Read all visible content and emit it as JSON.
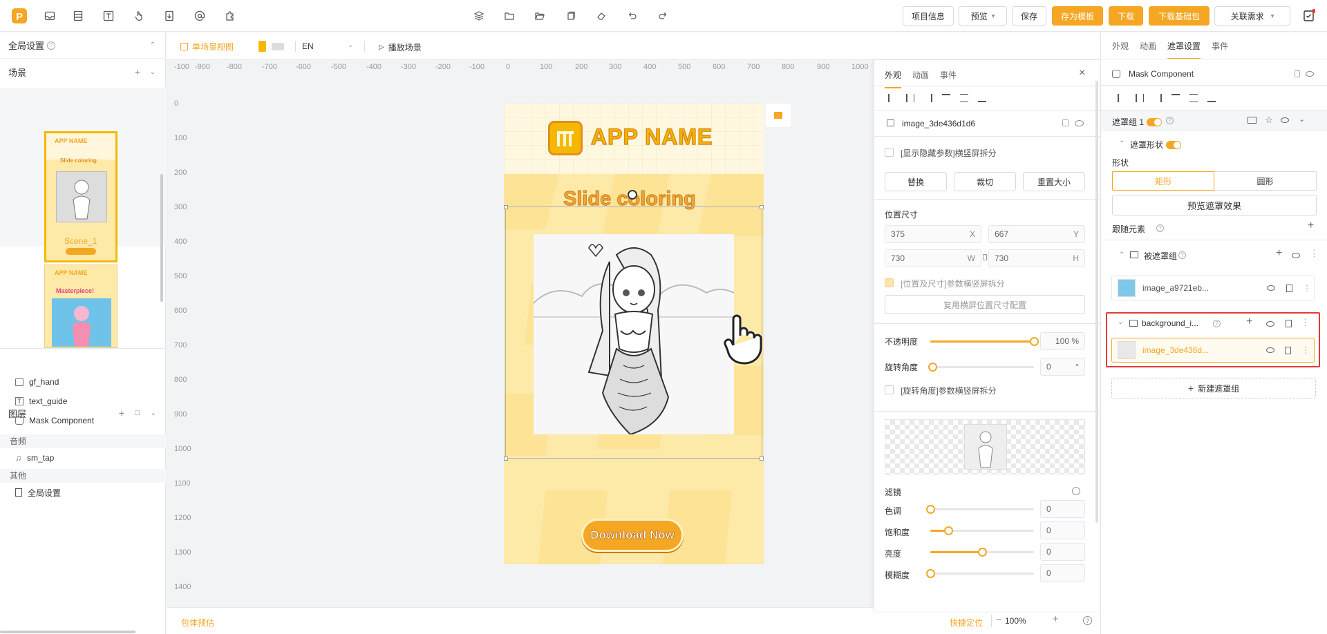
{
  "topbar": {
    "project_info": "项目信息",
    "preview": "预览",
    "save": "保存",
    "save_template": "存为模板",
    "download": "下载",
    "download_base": "下载基础包",
    "related": "关联需求"
  },
  "global_settings": {
    "title": "全局设置"
  },
  "scenes": {
    "title": "场景",
    "items": [
      {
        "name": "Scene_1",
        "app_name": "APP NAME",
        "subtitle": "Slide coloring"
      },
      {
        "app_name": "APP NAME",
        "subtitle": "Masterpiece!"
      }
    ]
  },
  "layers": {
    "title": "图层",
    "items": [
      {
        "label": "gf_hand"
      },
      {
        "label": "text_guide"
      },
      {
        "label": "Mask Component"
      }
    ],
    "audio_title": "音频",
    "audio_items": [
      {
        "label": "sm_tap"
      }
    ],
    "other_title": "其他",
    "other_items": [
      {
        "label": "全局设置"
      }
    ]
  },
  "view_toolbar": {
    "single_view": "单场景视图",
    "lang": "EN",
    "play": "播放场景"
  },
  "ruler": {
    "h": [
      "-100",
      "-900",
      "-800",
      "-700",
      "-600",
      "-500",
      "-400",
      "-300",
      "-200",
      "-100",
      "0",
      "100",
      "200",
      "300",
      "400",
      "500",
      "600",
      "700",
      "800",
      "900",
      "1000"
    ],
    "v": [
      "0",
      "100",
      "200",
      "300",
      "400",
      "500",
      "600",
      "700",
      "800",
      "900",
      "1000",
      "1100",
      "1200",
      "1300",
      "1400"
    ]
  },
  "canvas": {
    "app_name": "APP NAME",
    "headline": "Slide coloring",
    "cta": "Download Now"
  },
  "bottom": {
    "estimate": "包体预估",
    "locate": "快捷定位",
    "zoom": "100%"
  },
  "props": {
    "tabs": [
      "外观",
      "动画",
      "事件"
    ],
    "active_tab": 0,
    "element_name": "image_3de436d1d6",
    "show_hidden": "[显示隐藏参数]横竖屏拆分",
    "btn_replace": "替换",
    "btn_crop": "裁切",
    "btn_resize": "重置大小",
    "pos_size_title": "位置尺寸",
    "x": "375",
    "x_label": "X",
    "y": "667",
    "y_label": "Y",
    "w": "730",
    "w_label": "W",
    "h": "730",
    "h_label": "H",
    "pos_split": "[位置及尺寸]参数横竖屏拆分",
    "reuse_landscape": "复用横屏位置尺寸配置",
    "opacity_label": "不透明度",
    "opacity": "100",
    "opacity_unit": "%",
    "opacity_value": 1.0,
    "rotation_label": "旋转角度",
    "rotation": "0",
    "rotation_unit": "°",
    "rotation_split": "[旋转角度]参数横竖屏拆分",
    "filter_title": "滤镜",
    "filters": [
      {
        "label": "色调",
        "value": "0",
        "level": 0.0
      },
      {
        "label": "饱和度",
        "value": "0",
        "level": 0.17
      },
      {
        "label": "亮度",
        "value": "0",
        "level": 0.5
      },
      {
        "label": "模糊度",
        "value": "0",
        "level": 0.0
      }
    ]
  },
  "mask_panel": {
    "tabs": [
      "外观",
      "动画",
      "遮罩设置",
      "事件"
    ],
    "active_tab": 2,
    "title": "Mask Component",
    "group_label": "遮罩组 1",
    "shape_toggle_label": "遮罩形状",
    "shape_label": "形状",
    "shape_rect": "矩形",
    "shape_circle": "圆形",
    "preview": "预览遮罩效果",
    "follow": "跟随元素",
    "masked_group": "被遮罩组",
    "masked_item": "image_a9721eb...",
    "bg_group": "background_i...",
    "bg_item": "image_3de436d...",
    "new_group": "新建遮罩组"
  },
  "colors": {
    "accent": "#f5a623",
    "highlight": "#e53935"
  }
}
